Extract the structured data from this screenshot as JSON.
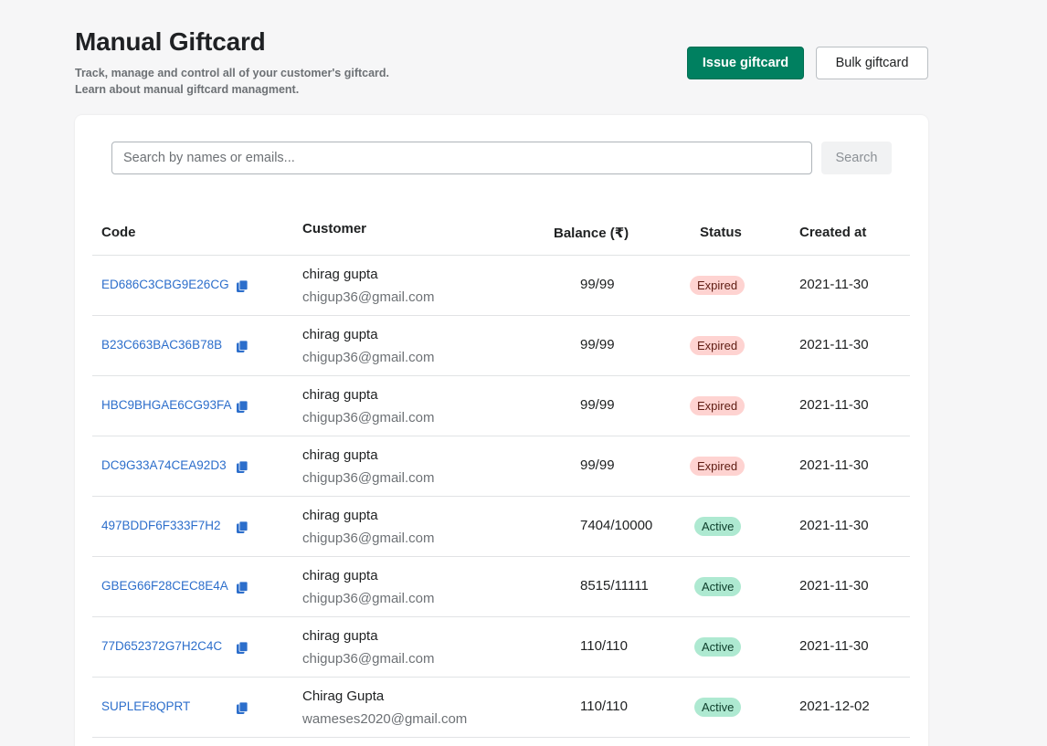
{
  "header": {
    "title": "Manual Giftcard",
    "subtitle_line1": "Track, manage and control all of your customer's giftcard.",
    "subtitle_line2": "Learn about manual giftcard managment.",
    "issue_label": "Issue giftcard",
    "bulk_label": "Bulk giftcard"
  },
  "search": {
    "placeholder": "Search by names or emails...",
    "button_label": "Search"
  },
  "table": {
    "columns": {
      "code": "Code",
      "customer": "Customer",
      "balance": "Balance (₹)",
      "status": "Status",
      "created": "Created at"
    },
    "rows": [
      {
        "code": "ED686C3CBG9E26CG",
        "name": "chirag gupta",
        "email": "chigup36@gmail.com",
        "balance": "99/99",
        "status": "Expired",
        "created": "2021-11-30"
      },
      {
        "code": "B23C663BAC36B78B",
        "name": "chirag gupta",
        "email": "chigup36@gmail.com",
        "balance": "99/99",
        "status": "Expired",
        "created": "2021-11-30"
      },
      {
        "code": "HBC9BHGAE6CG93FA",
        "name": "chirag gupta",
        "email": "chigup36@gmail.com",
        "balance": "99/99",
        "status": "Expired",
        "created": "2021-11-30"
      },
      {
        "code": "DC9G33A74CEA92D3",
        "name": "chirag gupta",
        "email": "chigup36@gmail.com",
        "balance": "99/99",
        "status": "Expired",
        "created": "2021-11-30"
      },
      {
        "code": "497BDDF6F333F7H2",
        "name": "chirag gupta",
        "email": "chigup36@gmail.com",
        "balance": "7404/10000",
        "status": "Active",
        "created": "2021-11-30"
      },
      {
        "code": "GBEG66F28CEC8E4A",
        "name": "chirag gupta",
        "email": "chigup36@gmail.com",
        "balance": "8515/11111",
        "status": "Active",
        "created": "2021-11-30"
      },
      {
        "code": "77D652372G7H2C4C",
        "name": "chirag gupta",
        "email": "chigup36@gmail.com",
        "balance": "110/110",
        "status": "Active",
        "created": "2021-11-30"
      },
      {
        "code": "SUPLEF8QPRT",
        "name": "Chirag Gupta",
        "email": "wameses2020@gmail.com",
        "balance": "110/110",
        "status": "Active",
        "created": "2021-12-02"
      }
    ]
  },
  "colors": {
    "primary": "#008060",
    "link": "#2c6ecb",
    "expired_bg": "#fed3d1",
    "active_bg": "#aee9d1"
  },
  "icons": {
    "copy": "copy-icon"
  }
}
